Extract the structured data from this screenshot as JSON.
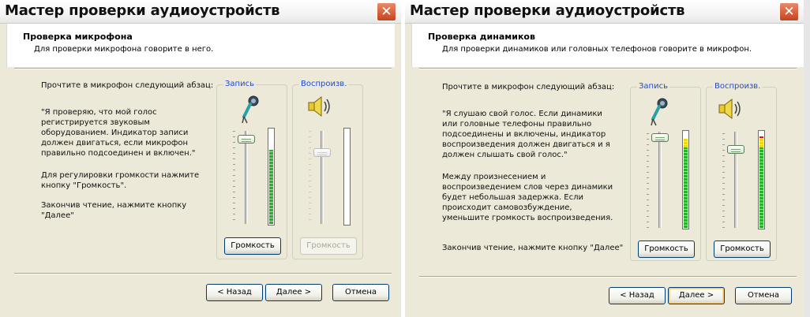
{
  "dialog_left": {
    "title": "Мастер проверки аудиоустройств",
    "close_glyph": "✕",
    "header_title": "Проверка микрофона",
    "header_subtitle": "Для проверки микрофона говорите в него.",
    "instruction_lead": "Прочтите в микрофон следующий абзац:",
    "passage_lines": [
      "\"Я проверяю, что мой голос",
      "регистрируется звуковым",
      "оборудованием. Индикатор записи",
      "должен двигаться, если микрофон",
      "правильно подсоединен и включен.\""
    ],
    "volume_hint_lines": [
      "Для регулировки громкости нажмите",
      "кнопку \"Громкость\"."
    ],
    "finish_lines": [
      "Закончив чтение, нажмите кнопку",
      "\"Далее\""
    ],
    "record_group_label": "Запись",
    "playback_group_label": "Воспроизв.",
    "record_volume_button": "Громкость",
    "playback_volume_button": "Громкость",
    "record_meter_level": 0.78,
    "playback_meter_level": 0.0,
    "record_slider_level": 0.9,
    "playback_slider_level": 0.75,
    "back_button": "< Назад",
    "next_button": "Далее >",
    "cancel_button": "Отмена"
  },
  "dialog_right": {
    "title": "Мастер проверки аудиоустройств",
    "close_glyph": "✕",
    "header_title": "Проверка динамиков",
    "header_subtitle": "Для проверки динамиков или головных телефонов говорите в микрофон.",
    "instruction_lead": "Прочтите в микрофон следующий абзац:",
    "passage_lines": [
      "\"Я слушаю свой голос. Если динамики",
      "или головные телефоны правильно",
      "подсоединены и включены, индикатор",
      "воспроизведения должен двигаться и я",
      "должен слышать свой голос.\""
    ],
    "delay_note_lines": [
      "Между произнесением и",
      "воспроизведением слов через динамики",
      "будет небольшая задержка. Если",
      "происходит самовозбуждение,",
      "уменьшите громкость воспроизведения."
    ],
    "finish_line": "Закончив чтение, нажмите кнопку \"Далее\"",
    "record_group_label": "Запись",
    "playback_group_label": "Воспроизв.",
    "record_volume_button": "Громкость",
    "playback_volume_button": "Громкость",
    "record_meter_level": 0.93,
    "playback_meter_level": 0.95,
    "record_slider_level": 0.93,
    "playback_slider_level": 0.8,
    "back_button": "< Назад",
    "next_button": "Далее >",
    "cancel_button": "Отмена"
  },
  "colors": {
    "dialog_bg": "#ece9d8",
    "group_label": "#1e4bd6",
    "close_button": "#c9421d",
    "meter_green": "#28b028",
    "meter_yellow": "#e8d818",
    "meter_red": "#d01818"
  },
  "icons": {
    "record": "microphone-icon",
    "playback": "speaker-icon",
    "close": "close-icon"
  }
}
